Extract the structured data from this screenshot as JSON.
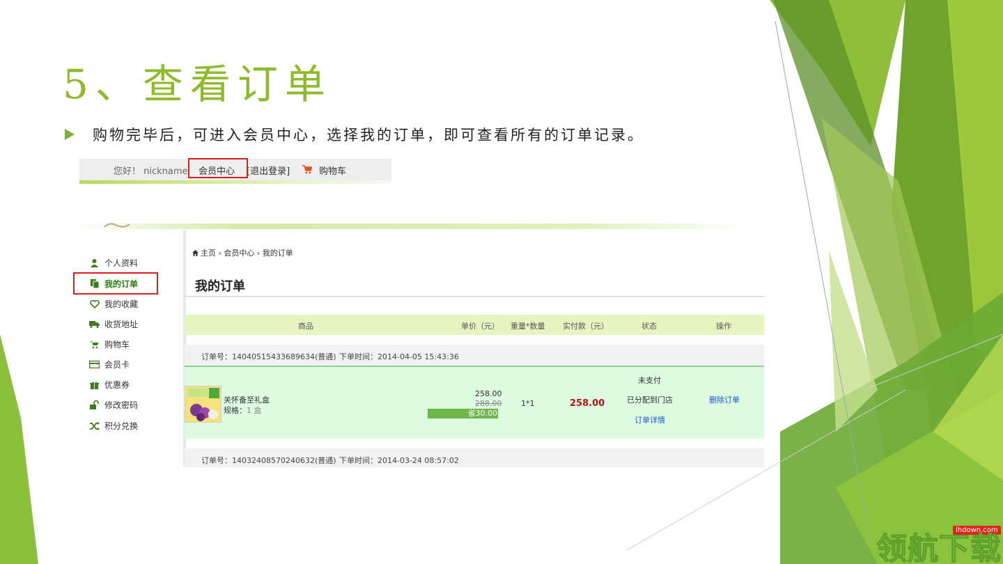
{
  "slide": {
    "title": "5、查看订单",
    "bullet": "购物完毕后，可进入会员中心，选择我的订单，即可查看所有的订单记录。"
  },
  "topbar": {
    "greeting": "您好！ nickname",
    "member_center": "会员中心",
    "logout": "[退出登录]",
    "cart": "购物车"
  },
  "sidebar": {
    "items": [
      {
        "label": "个人资料",
        "icon": "user-icon"
      },
      {
        "label": "我的订单",
        "icon": "orders-icon",
        "active": true
      },
      {
        "label": "我的收藏",
        "icon": "heart-icon"
      },
      {
        "label": "收货地址",
        "icon": "truck-icon"
      },
      {
        "label": "购物车",
        "icon": "cart-icon"
      },
      {
        "label": "会员卡",
        "icon": "card-icon"
      },
      {
        "label": "优惠券",
        "icon": "gift-icon"
      },
      {
        "label": "修改密码",
        "icon": "unlock-icon"
      },
      {
        "label": "积分兑换",
        "icon": "shuffle-icon"
      }
    ]
  },
  "breadcrumb": "主页 › 会员中心 › 我的订单",
  "page_heading": "我的订单",
  "table": {
    "headers": [
      "商品",
      "单价（元）",
      "重量*数量",
      "实付款（元）",
      "状态",
      "操作"
    ]
  },
  "orders": [
    {
      "order_no": "订单号：14040515433689634(普通)",
      "order_time": "下单时间：2014-04-05 15:43:36",
      "item_name": "关怀备至礼盒",
      "spec_label": "规格：",
      "spec_value": "1 盒",
      "price": "258.00",
      "orig_price": "288.00",
      "saved": "省30.00",
      "qty": "1*1",
      "paid": "258.00",
      "status_pay": "未支付",
      "status_store": "已分配到门店",
      "detail_link": "订单详情",
      "action": "删除订单"
    },
    {
      "order_no": "订单号：14032408570240632(普通)",
      "order_time": "下单时间：2014-03-24 08:57:02"
    }
  ],
  "watermark": {
    "small": "lhdown.com",
    "big": "领航下载"
  },
  "colors": {
    "title_green": "#8dbb2a",
    "accent_red": "#d9201e",
    "header_green": "#e6f4c2",
    "row_green": "#dcfbe0"
  }
}
